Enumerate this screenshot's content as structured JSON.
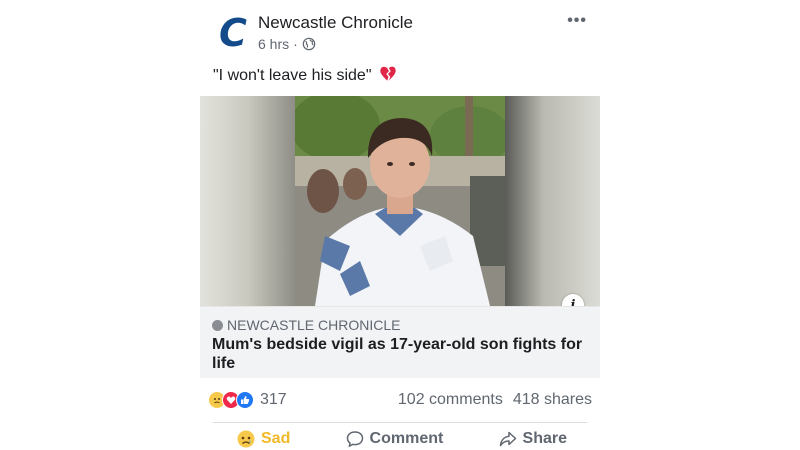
{
  "post": {
    "page_name": "Newcastle Chronicle",
    "logo_letter": "C",
    "time": "6 hrs",
    "separator": "·",
    "more_label": "•••",
    "caption": "\"I won't leave his side\""
  },
  "link_preview": {
    "source": "NEWCASTLE CHRONICLE",
    "title": "Mum's bedside vigil as 17-year-old son fights for life",
    "info_label": "i"
  },
  "stats": {
    "reaction_count": "317",
    "comments": "102 comments",
    "shares": "418 shares",
    "reaction_icons": [
      "sad-icon",
      "love-icon",
      "like-icon"
    ]
  },
  "actions": {
    "sad_label": "Sad",
    "comment_label": "Comment",
    "share_label": "Share"
  },
  "colors": {
    "accent_blue": "#2078f4",
    "sad_yellow": "#f0b92a",
    "love_red": "#f0284a",
    "logo_blue": "#134b8a"
  }
}
